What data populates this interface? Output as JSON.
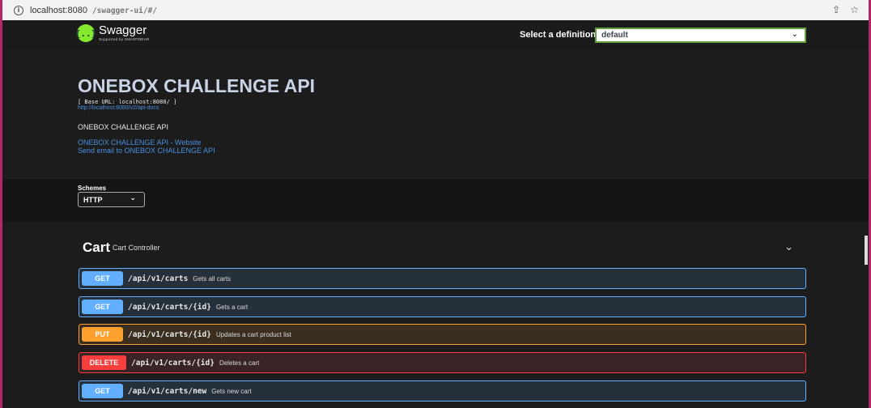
{
  "browser": {
    "url_host": "localhost:8080",
    "url_path": "/swagger-ui/#/"
  },
  "topbar": {
    "logo_name": "Swagger",
    "logo_sub": "Supported by SMARTBEAR",
    "logo_glyph": "{..}",
    "definition_label": "Select a definition",
    "definition_value": "default"
  },
  "info": {
    "title": "ONEBOX CHALLENGE API",
    "base_url": "[ Base URL: localhost:8080/ ]",
    "docs_link": "http://localhost:8080/v2/api-docs",
    "description": "ONEBOX CHALLENGE API",
    "website_link": "ONEBOX CHALLENGE API - Website",
    "email_link": "Send email to ONEBOX CHALLENGE API"
  },
  "schemes": {
    "label": "Schemes",
    "value": "HTTP"
  },
  "tag": {
    "name": "Cart",
    "description": "Cart Controller"
  },
  "operations": [
    {
      "method": "GET",
      "path": "/api/v1/carts",
      "summary": "Gets all carts"
    },
    {
      "method": "GET",
      "path": "/api/v1/carts/{id}",
      "summary": "Gets a cart"
    },
    {
      "method": "PUT",
      "path": "/api/v1/carts/{id}",
      "summary": "Updates a cart product list"
    },
    {
      "method": "DELETE",
      "path": "/api/v1/carts/{id}",
      "summary": "Deletes a cart"
    },
    {
      "method": "GET",
      "path": "/api/v1/carts/new",
      "summary": "Gets new cart"
    }
  ],
  "colors": {
    "get": "#61affe",
    "put": "#fca130",
    "delete": "#f93e3e",
    "swagger_green": "#85ea2d",
    "frame_border": "#b0276a"
  },
  "icons": {
    "info": "info-icon",
    "share": "share-icon",
    "star": "star-icon",
    "chevron": "chevron-down-icon"
  }
}
